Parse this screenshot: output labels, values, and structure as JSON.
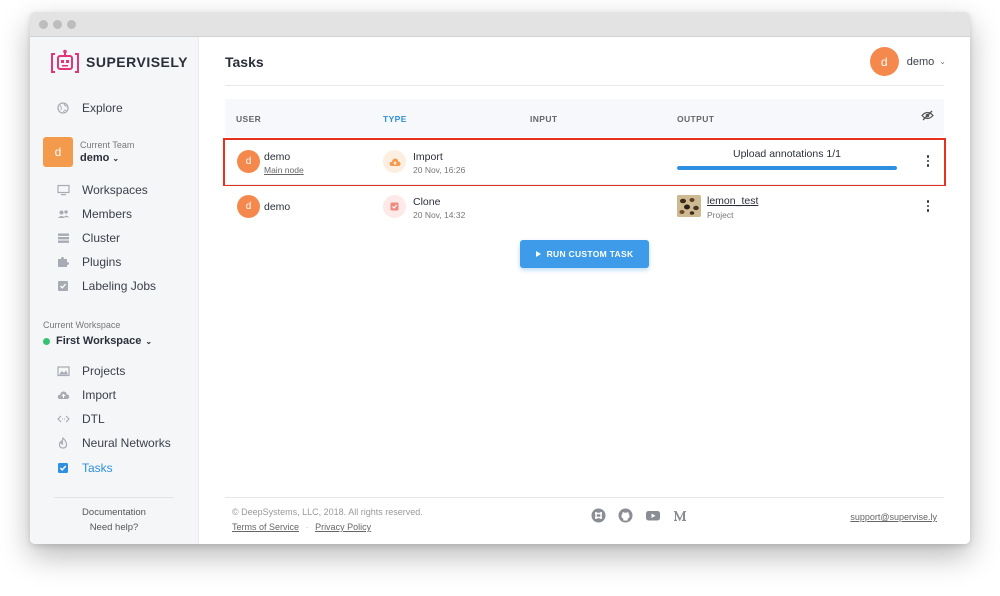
{
  "brand": {
    "name": "SUPERVISELY"
  },
  "sidebar": {
    "explore": "Explore",
    "team_label": "Current Team",
    "team_avatar": "d",
    "team_name": "demo",
    "team_items": [
      {
        "label": "Workspaces",
        "icon": "monitor-icon"
      },
      {
        "label": "Members",
        "icon": "members-icon"
      },
      {
        "label": "Cluster",
        "icon": "cluster-icon"
      },
      {
        "label": "Plugins",
        "icon": "puzzle-icon"
      },
      {
        "label": "Labeling Jobs",
        "icon": "checkbox-icon"
      }
    ],
    "workspace_label": "Current Workspace",
    "workspace_name": "First Workspace",
    "workspace_items": [
      {
        "label": "Projects",
        "icon": "images-icon"
      },
      {
        "label": "Import",
        "icon": "cloud-upload-icon"
      },
      {
        "label": "DTL",
        "icon": "code-icon"
      },
      {
        "label": "Neural Networks",
        "icon": "flame-icon"
      },
      {
        "label": "Tasks",
        "icon": "tasks-checkbox-icon",
        "active": true
      }
    ],
    "documentation": "Documentation",
    "help": "Need help?"
  },
  "header": {
    "title": "Tasks",
    "user_avatar": "d",
    "user_name": "demo"
  },
  "table": {
    "columns": [
      "USER",
      "TYPE",
      "INPUT",
      "OUTPUT"
    ],
    "rows": [
      {
        "avatar": "d",
        "user": "demo",
        "node": "Main node",
        "type": "Import",
        "date": "20 Nov, 16:26",
        "output_text": "Upload annotations 1/1",
        "progress": 1.0
      },
      {
        "avatar": "d",
        "user": "demo",
        "type": "Clone",
        "date": "20 Nov, 14:32",
        "output_name": "lemon_test",
        "output_sub": "Project"
      }
    ]
  },
  "run_button": "RUN CUSTOM TASK",
  "footer": {
    "copyright": "© DeepSystems, LLC, 2018. All rights reserved.",
    "terms": "Terms of Service",
    "privacy": "Privacy Policy",
    "support": "support@supervise.ly"
  },
  "colors": {
    "accent": "#2f8fe0",
    "avatar": "#f5894d",
    "highlight": "#e8301e",
    "online": "#38c172"
  }
}
